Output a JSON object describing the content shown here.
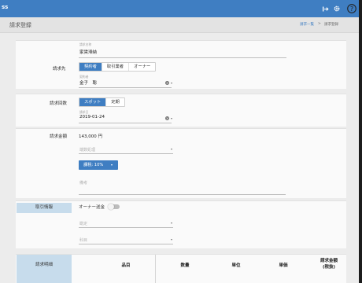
{
  "app": {
    "title": "ss"
  },
  "header": {
    "icons": [
      "logout-icon",
      "gear-icon",
      "help-icon"
    ]
  },
  "page": {
    "title": "請求登録",
    "breadcrumb": {
      "parent": "請求一覧",
      "separator": ">",
      "current": "請求登録"
    }
  },
  "billing_to": {
    "title_field": {
      "label": "請求名称",
      "value": "家賃滞納"
    },
    "label": "請求先",
    "options": [
      "契約者",
      "取引業者",
      "オーナー"
    ],
    "selected": "契約者",
    "person_field": {
      "label": "契約者",
      "value": "金子　聡"
    }
  },
  "billing_count": {
    "label": "請求回数",
    "options": [
      "スポット",
      "定期"
    ],
    "selected": "スポット",
    "date_field": {
      "label": "請求日",
      "value": "2019-01-24"
    }
  },
  "billing_amount": {
    "label": "請求金額",
    "amount": "143,000 円",
    "rounding_placeholder": "端数処理",
    "tax_button": "課税: 10%",
    "memo_placeholder": "備考"
  },
  "transaction": {
    "label": "取引情報",
    "owner_remit_label": "オーナー送金",
    "owner_remit_on": false,
    "account_placeholder": "勘定",
    "item_placeholder": "科目"
  },
  "details": {
    "label": "請求明細",
    "columns": [
      "品目",
      "数量",
      "単位",
      "単価",
      "請求金額\n(税抜)"
    ]
  },
  "colors": {
    "accent": "#3f7ec2",
    "side_label_bg": "#c7dcec"
  }
}
